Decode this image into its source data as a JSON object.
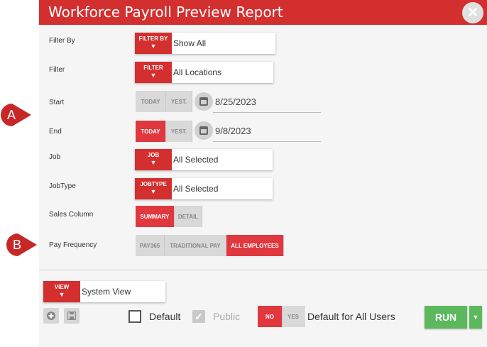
{
  "dialog": {
    "title": "Workforce Payroll Preview Report",
    "close_glyph": "×"
  },
  "annotations": {
    "a": "A",
    "b": "B"
  },
  "fields": {
    "filter_by": {
      "label": "Filter By",
      "tag": "FILTER BY",
      "value": "Show All"
    },
    "filter": {
      "label": "Filter",
      "tag": "FILTER",
      "value": "All Locations"
    },
    "start": {
      "label": "Start",
      "today": "TODAY",
      "yest": "YEST.",
      "value": "8/25/2023"
    },
    "end": {
      "label": "End",
      "today": "TODAY",
      "yest": "YEST.",
      "value": "9/8/2023"
    },
    "job": {
      "label": "Job",
      "tag": "JOB",
      "value": "All Selected"
    },
    "jobtype": {
      "label": "JobType",
      "tag": "JOBTYPE",
      "value": "All Selected"
    },
    "sales_column": {
      "label": "Sales Column",
      "options": [
        "SUMMARY",
        "DETAIL"
      ],
      "selected": "SUMMARY"
    },
    "pay_frequency": {
      "label": "Pay Frequency",
      "options": [
        "PAY365",
        "TRADITIONAL PAY",
        "ALL EMPLOYEES"
      ],
      "selected": "ALL EMPLOYEES"
    }
  },
  "footer": {
    "view_tag": "VIEW",
    "view_value": "System View",
    "default_label": "Default",
    "public_label": "Public",
    "no_label": "NO",
    "yes_label": "YES",
    "default_all_label": "Default for All Users",
    "run_label": "RUN",
    "arrow": "▼",
    "check": "✓"
  },
  "colors": {
    "accent": "#d32f2f",
    "run": "#5cb85c"
  },
  "icons": [
    "close-icon",
    "calendar-icon",
    "add-icon",
    "save-icon",
    "checkmark-icon",
    "dropdown-arrow-icon"
  ]
}
